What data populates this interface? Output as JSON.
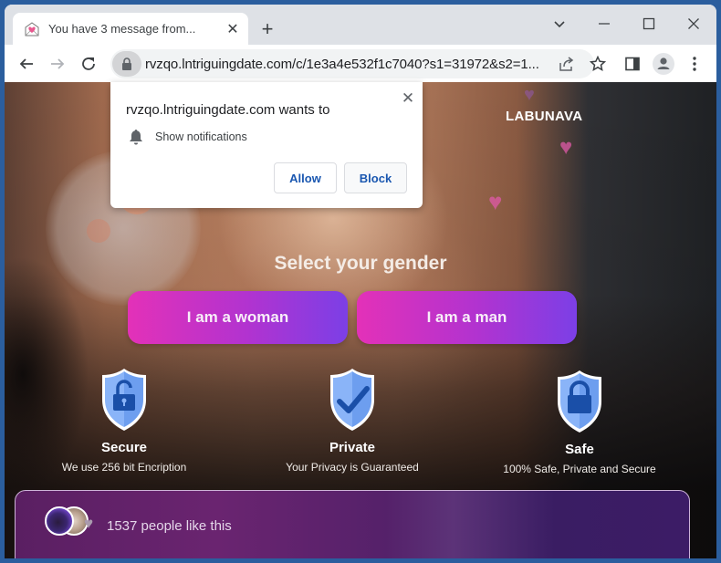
{
  "browser": {
    "tab": {
      "title": "You have 3 message from...",
      "favicon": "envelope-heart-icon",
      "close_label": "✕"
    },
    "new_tab_label": "+",
    "window_controls": {
      "tab_search": "chevron-down-icon",
      "minimize": "minimize-icon",
      "maximize": "maximize-icon",
      "close": "close-icon"
    },
    "toolbar": {
      "url": "rvzqo.lntriguingdate.com/c/1e3a4e532f1c7040?s1=31972&s2=1...",
      "icons": [
        "back-arrow-icon",
        "forward-arrow-icon",
        "reload-icon",
        "lock-icon",
        "share-icon",
        "star-icon",
        "side-panel-icon",
        "profile-icon",
        "menu-dots-icon"
      ]
    }
  },
  "permission_popup": {
    "title": "rvzqo.lntriguingdate.com wants to",
    "permission": "Show notifications",
    "allow_label": "Allow",
    "block_label": "Block",
    "close_label": "✕"
  },
  "page": {
    "brand": "LABUNAVA",
    "headline": "Select your gender",
    "buttons": {
      "woman": "I am a woman",
      "man": "I am a man"
    },
    "features": [
      {
        "icon": "shield-unlocked-padlock-icon",
        "title": "Secure",
        "description": "We use 256 bit Encription"
      },
      {
        "icon": "shield-checkmark-icon",
        "title": "Private",
        "description": "Your Privacy is Guaranteed"
      },
      {
        "icon": "shield-locked-padlock-icon",
        "title": "Safe",
        "description": "100% Safe, Private and Secure"
      }
    ],
    "likes": {
      "count_text": "1537 people like this"
    }
  },
  "colors": {
    "button_gradient_start": "#e331b8",
    "button_gradient_end": "#7c3fe6",
    "shield_light": "#8ab4f8",
    "shield_dark": "#1a4fa8",
    "popup_button_text": "#1a57b0",
    "likes_panel": "#5a1f62"
  }
}
